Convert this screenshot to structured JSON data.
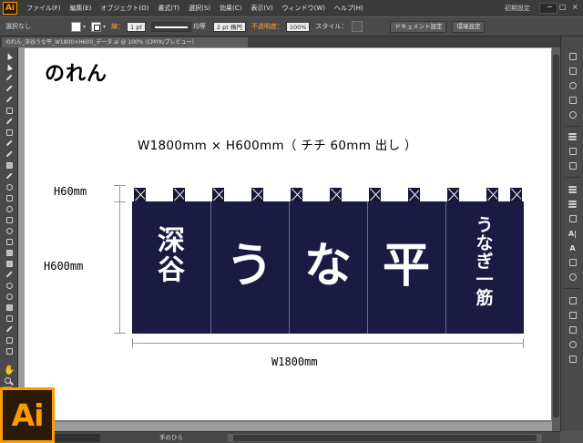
{
  "app": {
    "logo": "Ai",
    "workspace": "初期設定",
    "window_controls": [
      "−",
      "□",
      "×"
    ]
  },
  "menu": [
    "ファイル(F)",
    "編集(E)",
    "オブジェクト(O)",
    "書式(T)",
    "選択(S)",
    "効果(C)",
    "表示(V)",
    "ウィンドウ(W)",
    "ヘルプ(H)"
  ],
  "control_bar": {
    "selection": "選択なし",
    "stroke_label": "線：",
    "stroke_weight": "1 pt",
    "profile": "均等",
    "brush": "2 pt 楕円",
    "opacity_label": "不透明度：",
    "opacity": "100%",
    "style_label": "スタイル：",
    "doc_settings": "ドキュメント設定",
    "preferences": "環境設定"
  },
  "document_tab": "のれん_深谷うな平_W1800×H600_データ.ai @ 100% (CMYK/プレビュー)",
  "artboard": {
    "title": "のれん",
    "dimensions": "W1800mm × H600mm（ チチ 60mm 出し ）",
    "h60": "H60mm",
    "h600": "H600mm",
    "w1800": "W1800mm"
  },
  "noren": {
    "color": "#1a1a42",
    "tab_count": 11,
    "panel1": [
      "深",
      "谷"
    ],
    "panel2": "う",
    "panel3": "な",
    "panel4": "平",
    "panel5": [
      "う",
      "な",
      "ぎ",
      "一",
      "筋"
    ]
  },
  "status_bar": {
    "tool": "手のひら"
  },
  "colors": {
    "accent": "#ff9a00",
    "ui_dark": "#3b3b3b",
    "ui_mid": "#4a4a4a"
  }
}
